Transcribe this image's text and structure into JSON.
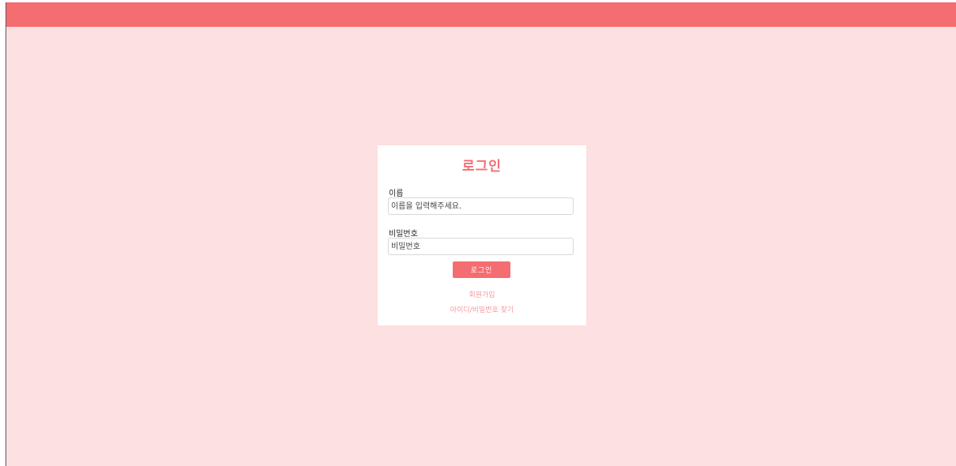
{
  "colors": {
    "accent": "#f46d71",
    "background": "#fde0e1",
    "card": "#ffffff",
    "link": "#f49a9d"
  },
  "login": {
    "title": "로그인",
    "name_label": "이름",
    "name_placeholder": "이름을 입력해주세요.",
    "password_label": "비밀번호",
    "password_placeholder": "비밀번호",
    "submit_label": "로그인",
    "signup_link": "회원가입",
    "find_account_link": "아이디/비밀번호 찾기"
  }
}
